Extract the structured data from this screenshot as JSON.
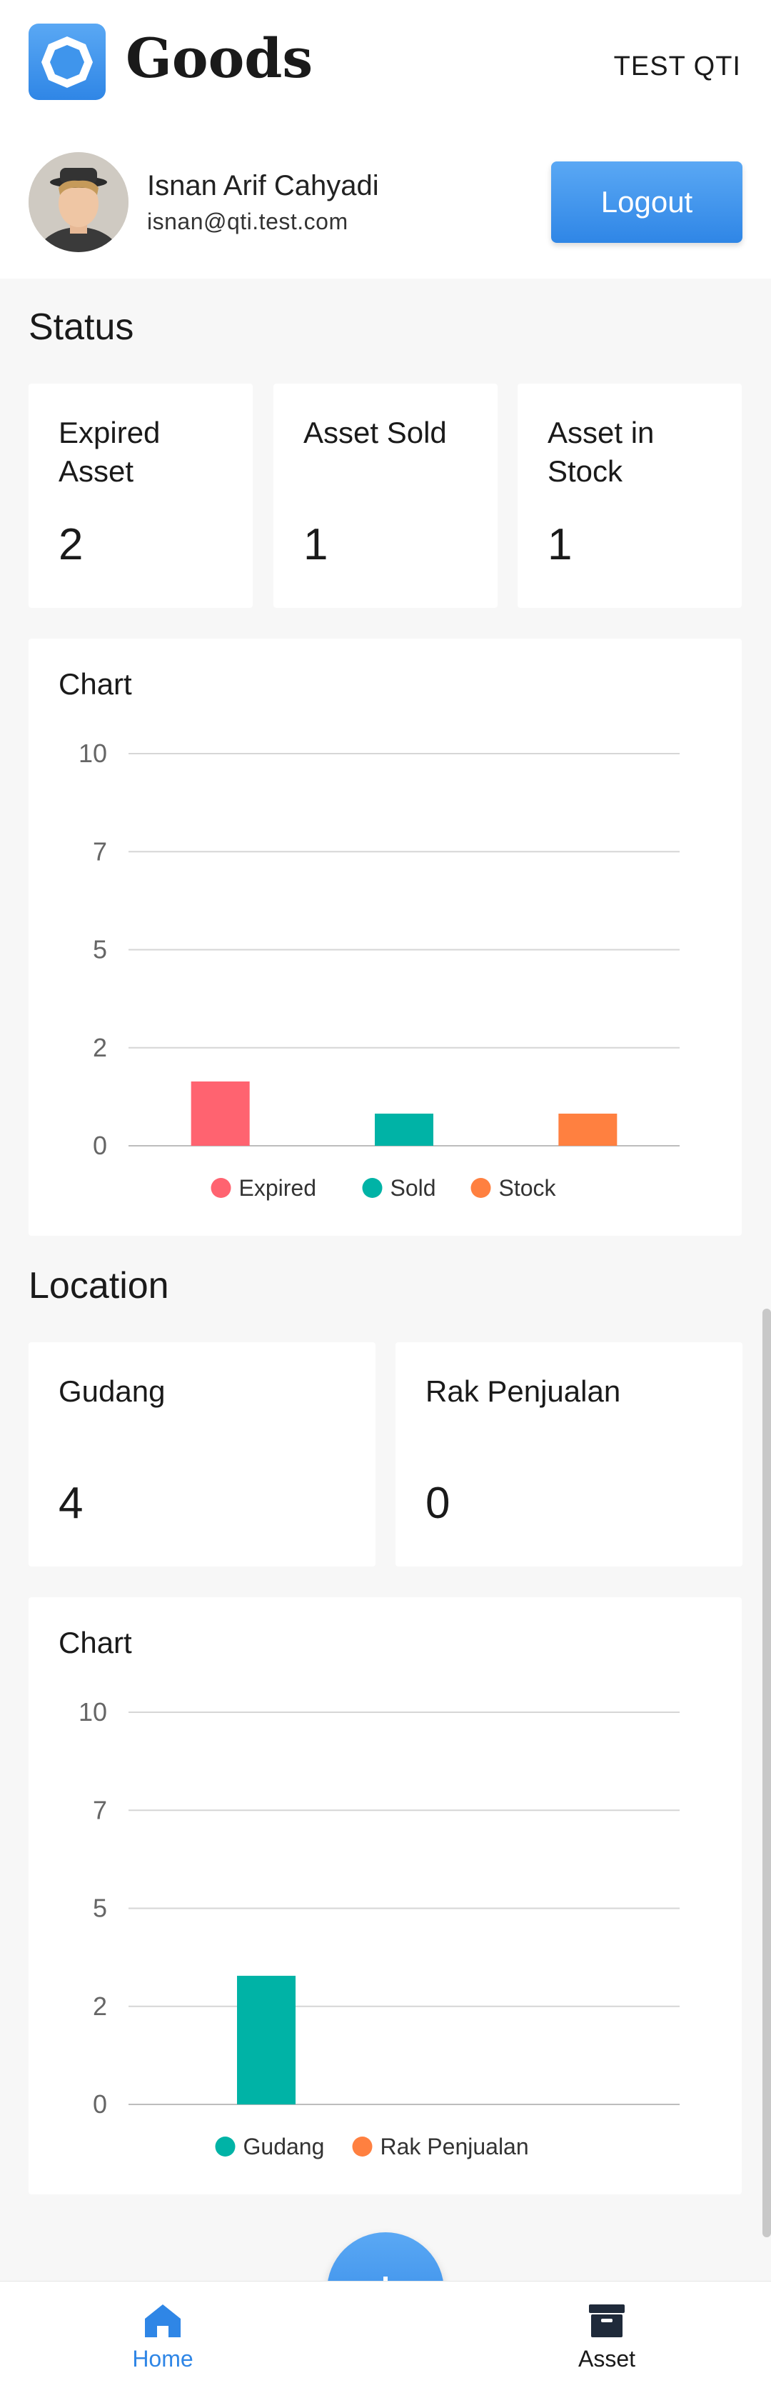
{
  "header": {
    "app_title": "Goods",
    "org_name": "TEST QTI",
    "user_name": "Isnan Arif Cahyadi",
    "user_email": "isnan@qti.test.com",
    "logout_label": "Logout"
  },
  "status": {
    "title": "Status",
    "cards": [
      {
        "label_line1": "Expired",
        "label_line2": "Asset",
        "value": "2"
      },
      {
        "label_line1": "Asset Sold",
        "label_line2": "",
        "value": "1"
      },
      {
        "label_line1": "Asset in",
        "label_line2": "Stock",
        "value": "1"
      }
    ],
    "chart_title": "Chart"
  },
  "location": {
    "title": "Location",
    "cards": [
      {
        "label": "Gudang",
        "value": "4"
      },
      {
        "label": "Rak Penjualan",
        "value": "0"
      }
    ],
    "chart_title": "Chart"
  },
  "nav": {
    "home_label": "Home",
    "asset_label": "Asset",
    "home_icon": "home-icon",
    "asset_icon": "archive-box-icon",
    "add_icon": "plus-icon"
  },
  "colors": {
    "accent": "#2f86e6",
    "expired": "#ff6370",
    "sold": "#00b3a6",
    "stock": "#ff8040"
  },
  "chart_data": [
    {
      "type": "bar",
      "title": "Chart",
      "categories": [
        "Expired",
        "Sold",
        "Stock"
      ],
      "values": [
        2,
        1,
        1
      ],
      "colors": [
        "#ff6370",
        "#00b3a6",
        "#ff8040"
      ],
      "yticks": [
        "10",
        "7",
        "5",
        "2",
        "0"
      ],
      "ylim": [
        0,
        10
      ],
      "grid": true,
      "legend": "bottom"
    },
    {
      "type": "bar",
      "title": "Chart",
      "categories": [
        "Gudang",
        "Rak Penjualan"
      ],
      "values": [
        4,
        0
      ],
      "colors": [
        "#00b3a6",
        "#ff8040"
      ],
      "yticks": [
        "10",
        "7",
        "5",
        "2",
        "0"
      ],
      "ylim": [
        0,
        10
      ],
      "grid": true,
      "legend": "bottom"
    }
  ]
}
